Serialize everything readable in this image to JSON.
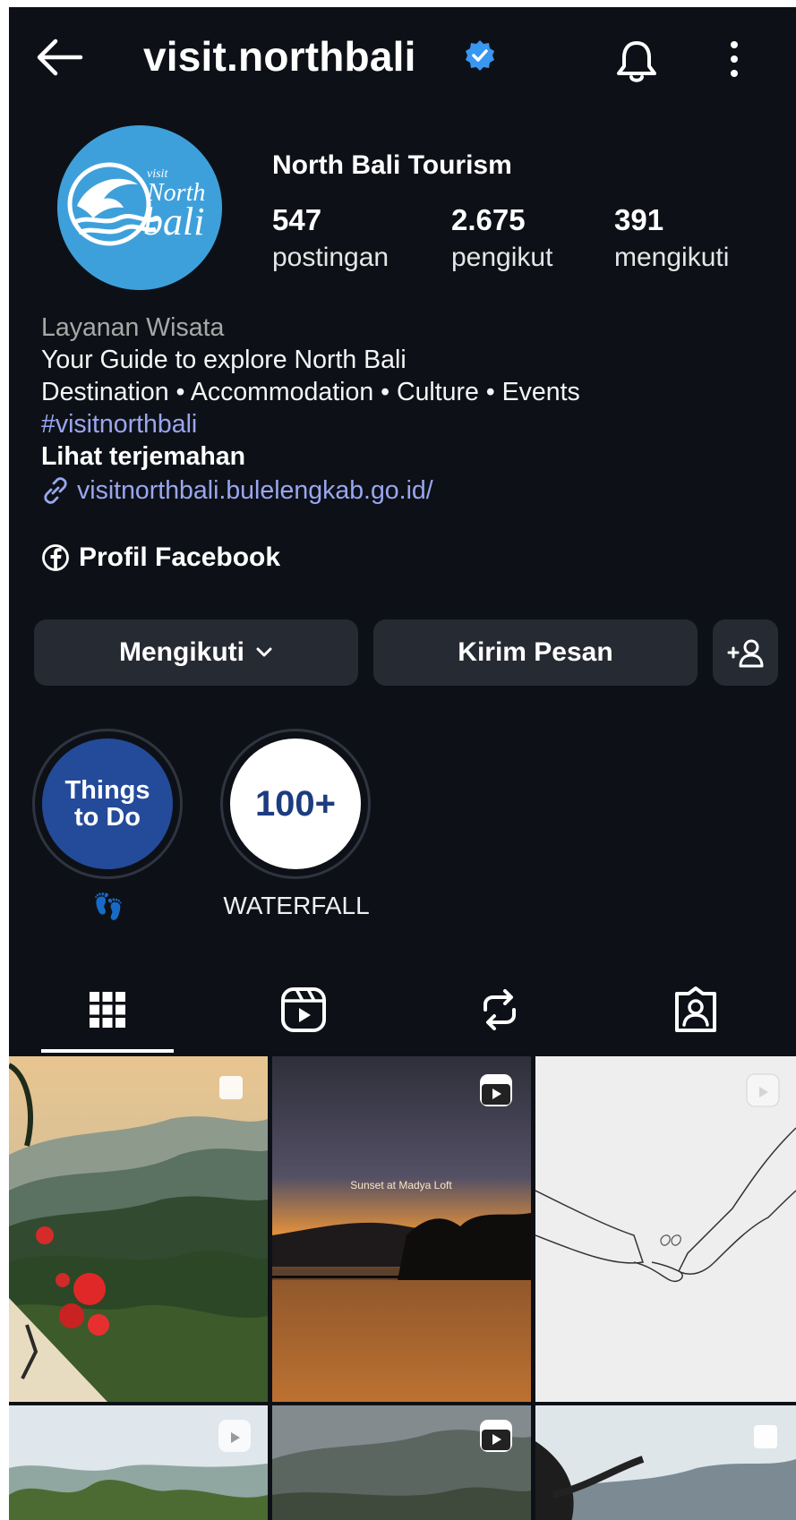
{
  "header": {
    "username": "visit.northbali"
  },
  "profile": {
    "name": "North Bali Tourism",
    "stats": [
      {
        "value": "547",
        "label": "postingan"
      },
      {
        "value": "2.675",
        "label": "pengikut"
      },
      {
        "value": "391",
        "label": "mengikuti"
      }
    ],
    "category": "Layanan Wisata",
    "bio_lines": [
      "Your Guide to explore North Bali",
      "Destination • Accommodation • Culture •  Events"
    ],
    "hashtag": "#visitnorthbali",
    "translate": "Lihat terjemahan",
    "link": "visitnorthbali.bulelengkab.go.id/",
    "facebook": "Profil Facebook",
    "avatar_text": {
      "top": "visit",
      "mid": "North",
      "bottom": "bali"
    }
  },
  "actions": {
    "following": "Mengikuti",
    "message": "Kirim Pesan"
  },
  "highlights": [
    {
      "cover_text_1": "Things",
      "cover_text_2": "to Do",
      "caption": "👣"
    },
    {
      "cover_text_1": "100+",
      "caption": "WATERFALL"
    }
  ],
  "grid": {
    "overlay_text": "Sunset at Madya Loft"
  },
  "colors": {
    "background": "#0d1117",
    "accent_link": "#9aa6ef",
    "verified": "#3897f0",
    "avatar": "#3ea0db",
    "button": "#262a33"
  },
  "icons": [
    "back-arrow-icon",
    "verified-badge-icon",
    "bell-icon",
    "more-options-icon",
    "link-icon",
    "facebook-icon",
    "chevron-down-icon",
    "add-person-icon",
    "grid-icon",
    "reels-icon",
    "reposts-icon",
    "tagged-icon",
    "carousel-icon"
  ]
}
